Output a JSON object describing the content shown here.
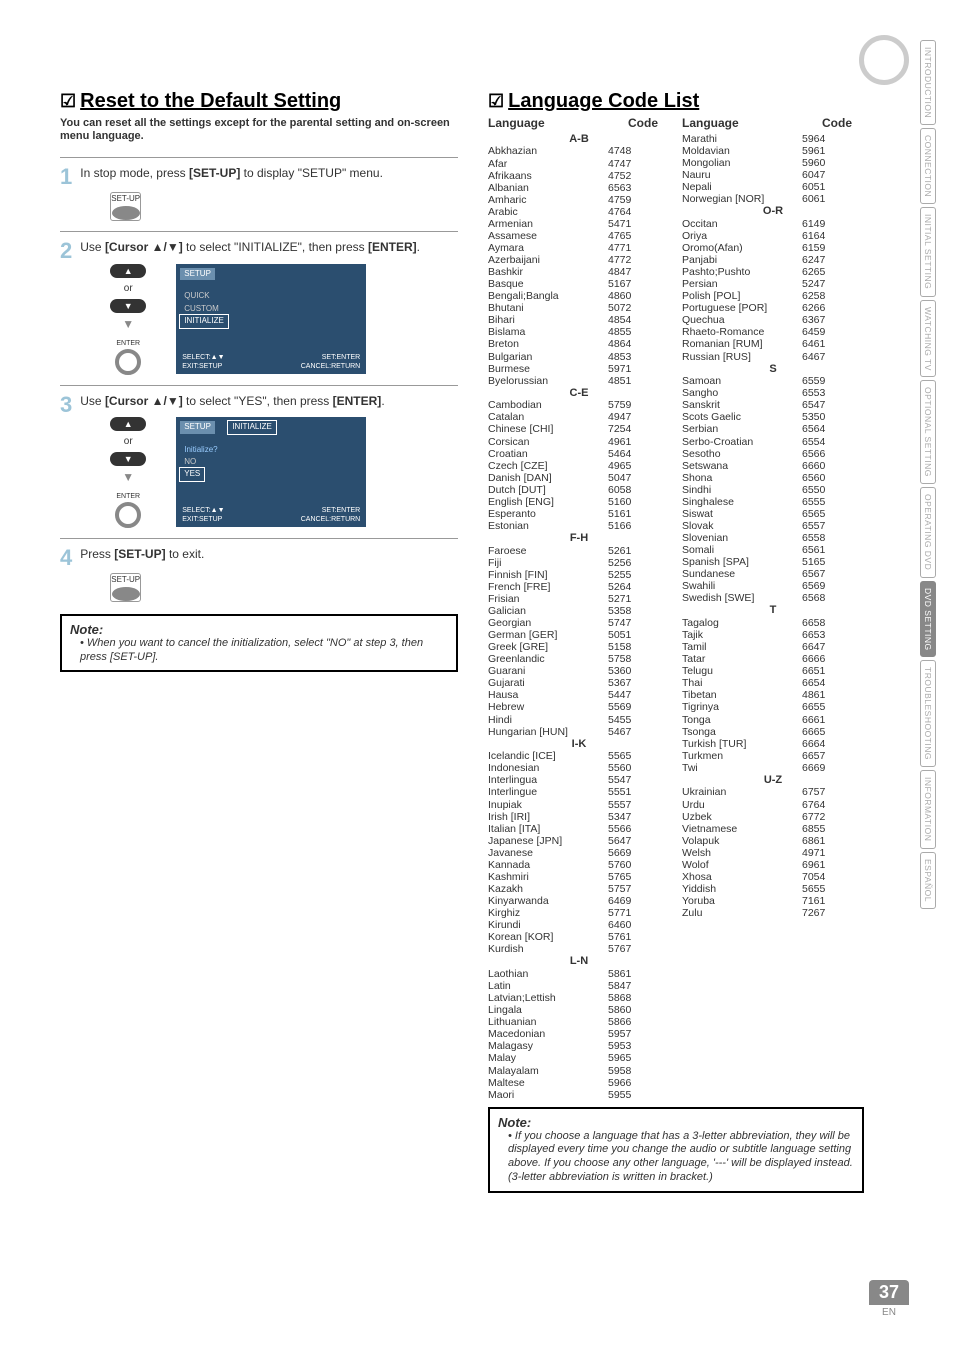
{
  "sideTabs": [
    {
      "label": "INTRODUCTION"
    },
    {
      "label": "CONNECTION"
    },
    {
      "label": "INITIAL SETTING"
    },
    {
      "label": "WATCHING TV"
    },
    {
      "label": "OPTIONAL SETTING"
    },
    {
      "label": "OPERATING DVD"
    },
    {
      "label": "DVD SETTING",
      "active": true
    },
    {
      "label": "TROUBLESHOOTING"
    },
    {
      "label": "INFORMATION"
    },
    {
      "label": "ESPAÑOL"
    }
  ],
  "left": {
    "title": "Reset to the Default Setting",
    "subtitle": "You can reset all the settings except for the parental setting and on-screen menu language.",
    "step1": {
      "num": "1",
      "text_a": "In stop mode, press ",
      "text_b": "[SET-UP]",
      "text_c": " to display \"SETUP\" menu.",
      "btn": "SET-UP"
    },
    "step2": {
      "num": "2",
      "text_a": "Use ",
      "text_b": "[Cursor ▲/▼]",
      "text_c": " to select \"INITIALIZE\", then press ",
      "text_d": "[ENTER]",
      "text_e": ".",
      "or": "or",
      "enter": "ENTER",
      "menu": {
        "hdr": "SETUP",
        "items": [
          "QUICK",
          "CUSTOM",
          "INITIALIZE"
        ],
        "foot_l1": "SELECT:▲▼",
        "foot_l2": "EXIT:SETUP",
        "foot_r1": "SET:ENTER",
        "foot_r2": "CANCEL:RETURN"
      }
    },
    "step3": {
      "num": "3",
      "text_a": "Use ",
      "text_b": "[Cursor ▲/▼]",
      "text_c": " to select \"YES\", then press ",
      "text_d": "[ENTER]",
      "text_e": ".",
      "or": "or",
      "enter": "ENTER",
      "menu": {
        "hdr": "SETUP",
        "tag": "INITIALIZE",
        "sub": "Initialize?",
        "items": [
          "NO",
          "YES"
        ],
        "foot_l1": "SELECT:▲▼",
        "foot_l2": "EXIT:SETUP",
        "foot_r1": "SET:ENTER",
        "foot_r2": "CANCEL:RETURN"
      }
    },
    "step4": {
      "num": "4",
      "text_a": "Press ",
      "text_b": "[SET-UP]",
      "text_c": " to exit.",
      "btn": "SET-UP"
    },
    "note": {
      "title": "Note:",
      "text": "When you want to cancel the initialization, select \"NO\" at step 3, then press [SET-UP]."
    }
  },
  "right": {
    "title": "Language Code List",
    "hdr_lang": "Language",
    "hdr_code": "Code",
    "groups1": [
      {
        "g": "A-B",
        "rows": [
          [
            "Abkhazian",
            "4748"
          ],
          [
            "Afar",
            "4747"
          ],
          [
            "Afrikaans",
            "4752"
          ],
          [
            "Albanian",
            "6563"
          ],
          [
            "Amharic",
            "4759"
          ],
          [
            "Arabic",
            "4764"
          ],
          [
            "Armenian",
            "5471"
          ],
          [
            "Assamese",
            "4765"
          ],
          [
            "Aymara",
            "4771"
          ],
          [
            "Azerbaijani",
            "4772"
          ],
          [
            "Bashkir",
            "4847"
          ],
          [
            "Basque",
            "5167"
          ],
          [
            "Bengali;Bangla",
            "4860"
          ],
          [
            "Bhutani",
            "5072"
          ],
          [
            "Bihari",
            "4854"
          ],
          [
            "Bislama",
            "4855"
          ],
          [
            "Breton",
            "4864"
          ],
          [
            "Bulgarian",
            "4853"
          ],
          [
            "Burmese",
            "5971"
          ],
          [
            "Byelorussian",
            "4851"
          ]
        ]
      },
      {
        "g": "C-E",
        "rows": [
          [
            "Cambodian",
            "5759"
          ],
          [
            "Catalan",
            "4947"
          ],
          [
            "Chinese [CHI]",
            "7254"
          ],
          [
            "Corsican",
            "4961"
          ],
          [
            "Croatian",
            "5464"
          ],
          [
            "Czech [CZE]",
            "4965"
          ],
          [
            "Danish [DAN]",
            "5047"
          ],
          [
            "Dutch [DUT]",
            "6058"
          ],
          [
            "English [ENG]",
            "5160"
          ],
          [
            "Esperanto",
            "5161"
          ],
          [
            "Estonian",
            "5166"
          ]
        ]
      },
      {
        "g": "F-H",
        "rows": [
          [
            "Faroese",
            "5261"
          ],
          [
            "Fiji",
            "5256"
          ],
          [
            "Finnish [FIN]",
            "5255"
          ],
          [
            "French [FRE]",
            "5264"
          ],
          [
            "Frisian",
            "5271"
          ],
          [
            "Galician",
            "5358"
          ],
          [
            "Georgian",
            "5747"
          ],
          [
            "German [GER]",
            "5051"
          ],
          [
            "Greek [GRE]",
            "5158"
          ],
          [
            "Greenlandic",
            "5758"
          ],
          [
            "Guarani",
            "5360"
          ],
          [
            "Gujarati",
            "5367"
          ],
          [
            "Hausa",
            "5447"
          ],
          [
            "Hebrew",
            "5569"
          ],
          [
            "Hindi",
            "5455"
          ],
          [
            "Hungarian [HUN]",
            "5467"
          ]
        ]
      },
      {
        "g": "I-K",
        "rows": [
          [
            "Icelandic [ICE]",
            "5565"
          ],
          [
            "Indonesian",
            "5560"
          ],
          [
            "Interlingua",
            "5547"
          ],
          [
            "Interlingue",
            "5551"
          ],
          [
            "Inupiak",
            "5557"
          ],
          [
            "Irish [IRI]",
            "5347"
          ],
          [
            "Italian [ITA]",
            "5566"
          ],
          [
            "Japanese [JPN]",
            "5647"
          ],
          [
            "Javanese",
            "5669"
          ],
          [
            "Kannada",
            "5760"
          ],
          [
            "Kashmiri",
            "5765"
          ],
          [
            "Kazakh",
            "5757"
          ],
          [
            "Kinyarwanda",
            "6469"
          ],
          [
            "Kirghiz",
            "5771"
          ],
          [
            "Kirundi",
            "6460"
          ],
          [
            "Korean [KOR]",
            "5761"
          ],
          [
            "Kurdish",
            "5767"
          ]
        ]
      },
      {
        "g": "L-N",
        "rows": [
          [
            "Laothian",
            "5861"
          ],
          [
            "Latin",
            "5847"
          ],
          [
            "Latvian;Lettish",
            "5868"
          ],
          [
            "Lingala",
            "5860"
          ],
          [
            "Lithuanian",
            "5866"
          ],
          [
            "Macedonian",
            "5957"
          ],
          [
            "Malagasy",
            "5953"
          ],
          [
            "Malay",
            "5965"
          ],
          [
            "Malayalam",
            "5958"
          ],
          [
            "Maltese",
            "5966"
          ],
          [
            "Maori",
            "5955"
          ]
        ]
      }
    ],
    "groups2": [
      {
        "g": "",
        "rows": [
          [
            "Marathi",
            "5964"
          ],
          [
            "Moldavian",
            "5961"
          ],
          [
            "Mongolian",
            "5960"
          ],
          [
            "Nauru",
            "6047"
          ],
          [
            "Nepali",
            "6051"
          ],
          [
            "Norwegian [NOR]",
            "6061"
          ]
        ]
      },
      {
        "g": "O-R",
        "rows": [
          [
            "Occitan",
            "6149"
          ],
          [
            "Oriya",
            "6164"
          ],
          [
            "Oromo(Afan)",
            "6159"
          ],
          [
            "Panjabi",
            "6247"
          ],
          [
            "Pashto;Pushto",
            "6265"
          ],
          [
            "Persian",
            "5247"
          ],
          [
            "Polish [POL]",
            "6258"
          ],
          [
            "Portuguese [POR]",
            "6266"
          ],
          [
            "Quechua",
            "6367"
          ],
          [
            "Rhaeto-Romance",
            "6459"
          ],
          [
            "Romanian [RUM]",
            "6461"
          ],
          [
            "Russian [RUS]",
            "6467"
          ]
        ]
      },
      {
        "g": "S",
        "rows": [
          [
            "Samoan",
            "6559"
          ],
          [
            "Sangho",
            "6553"
          ],
          [
            "Sanskrit",
            "6547"
          ],
          [
            "Scots Gaelic",
            "5350"
          ],
          [
            "Serbian",
            "6564"
          ],
          [
            "Serbo-Croatian",
            "6554"
          ],
          [
            "Sesotho",
            "6566"
          ],
          [
            "Setswana",
            "6660"
          ],
          [
            "Shona",
            "6560"
          ],
          [
            "Sindhi",
            "6550"
          ],
          [
            "Singhalese",
            "6555"
          ],
          [
            "Siswat",
            "6565"
          ],
          [
            "Slovak",
            "6557"
          ],
          [
            "Slovenian",
            "6558"
          ],
          [
            "Somali",
            "6561"
          ],
          [
            "Spanish [SPA]",
            "5165"
          ],
          [
            "Sundanese",
            "6567"
          ],
          [
            "Swahili",
            "6569"
          ],
          [
            "Swedish [SWE]",
            "6568"
          ]
        ]
      },
      {
        "g": "T",
        "rows": [
          [
            "Tagalog",
            "6658"
          ],
          [
            "Tajik",
            "6653"
          ],
          [
            "Tamil",
            "6647"
          ],
          [
            "Tatar",
            "6666"
          ],
          [
            "Telugu",
            "6651"
          ],
          [
            "Thai",
            "6654"
          ],
          [
            "Tibetan",
            "4861"
          ],
          [
            "Tigrinya",
            "6655"
          ],
          [
            "Tonga",
            "6661"
          ],
          [
            "Tsonga",
            "6665"
          ],
          [
            "Turkish [TUR]",
            "6664"
          ],
          [
            "Turkmen",
            "6657"
          ],
          [
            "Twi",
            "6669"
          ]
        ]
      },
      {
        "g": "U-Z",
        "rows": [
          [
            "Ukrainian",
            "6757"
          ],
          [
            "Urdu",
            "6764"
          ],
          [
            "Uzbek",
            "6772"
          ],
          [
            "Vietnamese",
            "6855"
          ],
          [
            "Volapuk",
            "6861"
          ],
          [
            "Welsh",
            "4971"
          ],
          [
            "Wolof",
            "6961"
          ],
          [
            "Xhosa",
            "7054"
          ],
          [
            "Yiddish",
            "5655"
          ],
          [
            "Yoruba",
            "7161"
          ],
          [
            "Zulu",
            "7267"
          ]
        ]
      }
    ],
    "note": {
      "title": "Note:",
      "text": "If you choose a language that has a 3-letter abbreviation, they will be displayed every time you change the audio or subtitle language setting above. If you choose any other language, '---' will be displayed instead. (3-letter abbreviation is written in bracket.)"
    }
  },
  "pagenum": "37",
  "en": "EN"
}
